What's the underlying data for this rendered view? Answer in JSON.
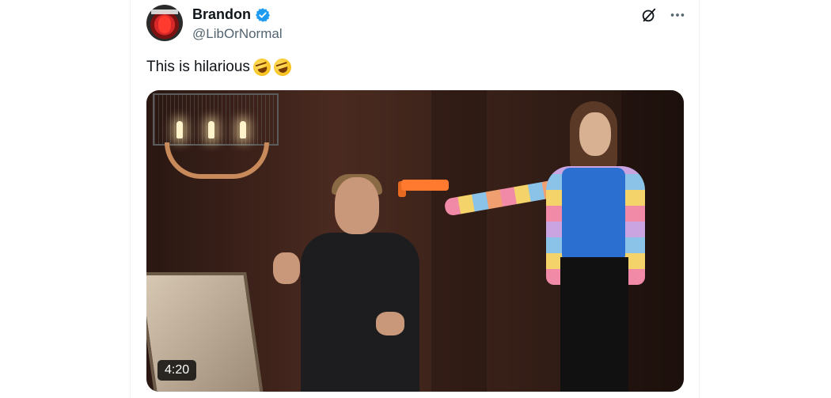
{
  "post": {
    "author_name": "Brandon",
    "author_handle": "@LibOrNormal",
    "verified": true,
    "text": "This is hilarious",
    "emojis": [
      "rolling-on-floor-laughing",
      "rolling-on-floor-laughing"
    ],
    "media": {
      "type": "video",
      "duration": "4:20"
    }
  },
  "colors": {
    "verified_badge": "#1d9bf0",
    "handle_text": "#536471",
    "primary_text": "#0f1419"
  },
  "icons": {
    "grok": "grok-icon",
    "more": "more-icon"
  }
}
